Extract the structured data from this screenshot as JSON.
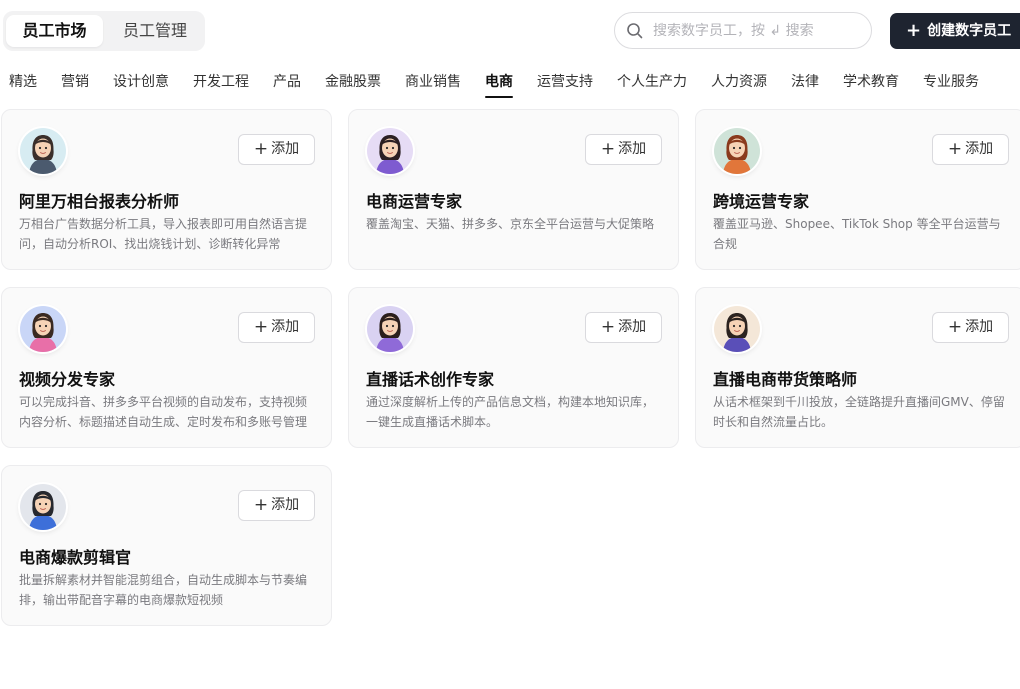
{
  "header": {
    "segments": [
      {
        "label": "员工市场",
        "active": true
      },
      {
        "label": "员工管理",
        "active": false
      }
    ],
    "search": {
      "placeholder": "搜索数字员工，按 ↲ 搜索",
      "value": ""
    },
    "create_button": "创建数字员工"
  },
  "categories": [
    {
      "label": "精选",
      "active": false
    },
    {
      "label": "营销",
      "active": false
    },
    {
      "label": "设计创意",
      "active": false
    },
    {
      "label": "开发工程",
      "active": false
    },
    {
      "label": "产品",
      "active": false
    },
    {
      "label": "金融股票",
      "active": false
    },
    {
      "label": "商业销售",
      "active": false
    },
    {
      "label": "电商",
      "active": true
    },
    {
      "label": "运营支持",
      "active": false
    },
    {
      "label": "个人生产力",
      "active": false
    },
    {
      "label": "人力资源",
      "active": false
    },
    {
      "label": "法律",
      "active": false
    },
    {
      "label": "学术教育",
      "active": false
    },
    {
      "label": "专业服务",
      "active": false
    }
  ],
  "add_label": "添加",
  "cards": [
    {
      "title": "阿里万相台报表分析师",
      "desc": "万相台广告数据分析工具，导入报表即可用自然语言提问，自动分析ROI、找出烧钱计划、诊断转化异常",
      "avatar": "analyst-avatar",
      "bg": "#d7ecf2",
      "hair": "#3a2f2b",
      "shirt": "#4b5a6e"
    },
    {
      "title": "电商运营专家",
      "desc": "覆盖淘宝、天猫、拼多多、京东全平台运营与大促策略",
      "avatar": "ecommerce-ops-avatar",
      "bg": "#e6dcf5",
      "hair": "#2b1f22",
      "shirt": "#7e5bd0"
    },
    {
      "title": "跨境运营专家",
      "desc": "覆盖亚马逊、Shopee、TikTok Shop 等全平台运营与合规",
      "avatar": "cross-border-avatar",
      "bg": "#cfe3d8",
      "hair": "#8a3a1d",
      "shirt": "#e1763a"
    },
    {
      "title": "视频分发专家",
      "desc": "可以完成抖音、拼多多平台视频的自动发布，支持视频内容分析、标题描述自动生成、定时发布和多账号管理",
      "avatar": "video-distributor-avatar",
      "bg": "#c9d6f7",
      "hair": "#3a2a22",
      "shirt": "#e86fa8"
    },
    {
      "title": "直播话术创作专家",
      "desc": "通过深度解析上传的产品信息文档，构建本地知识库，一键生成直播话术脚本。",
      "avatar": "livestream-script-avatar",
      "bg": "#d9d2f2",
      "hair": "#2a1e1c",
      "shirt": "#8f6ad8"
    },
    {
      "title": "直播电商带货策略师",
      "desc": "从话术框架到千川投放，全链路提升直播间GMV、停留时长和自然流量占比。",
      "avatar": "livestream-strategist-avatar",
      "bg": "#f4e7d8",
      "hair": "#2b2320",
      "shirt": "#5a4fb8"
    },
    {
      "title": "电商爆款剪辑官",
      "desc": "批量拆解素材并智能混剪组合，自动生成脚本与节奏编排，输出带配音字幕的电商爆款短视频",
      "avatar": "video-editor-avatar",
      "bg": "#e3e6ec",
      "hair": "#26282e",
      "shirt": "#3d6fd9"
    }
  ]
}
